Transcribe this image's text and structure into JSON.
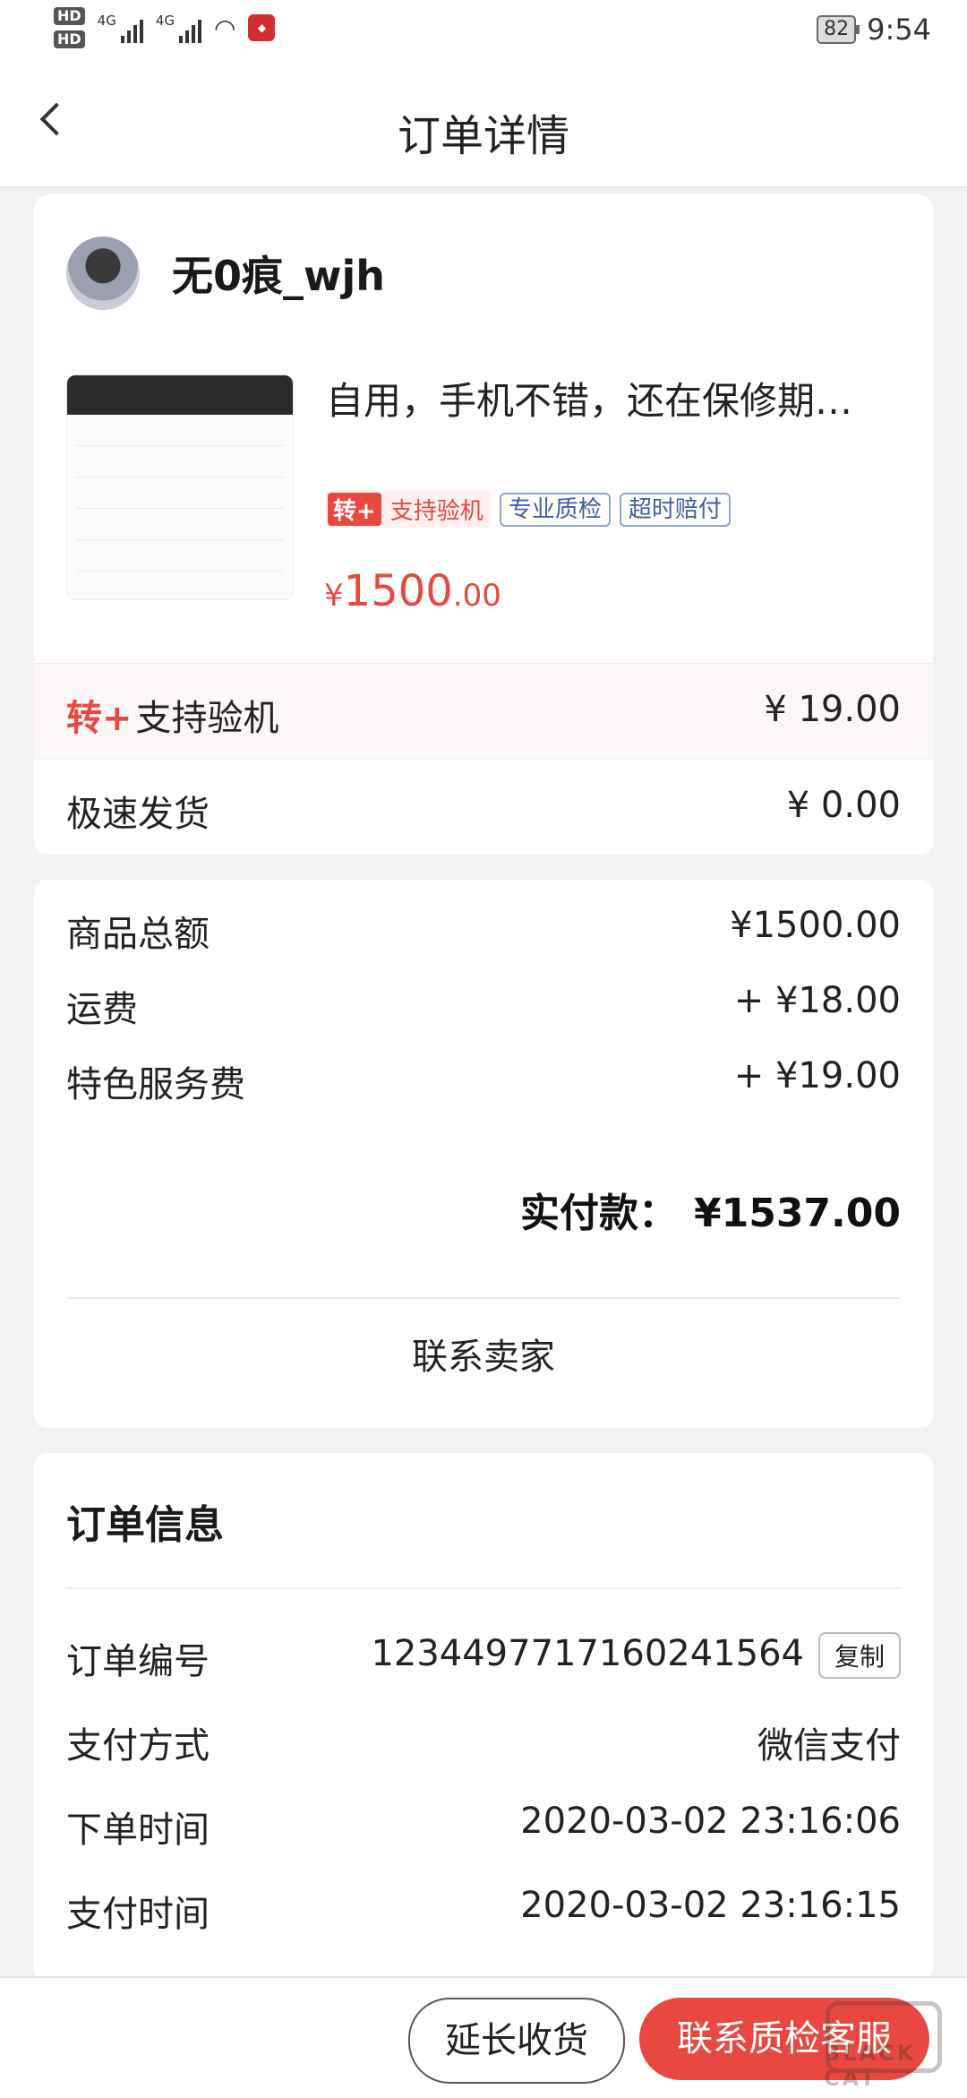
{
  "status_bar": {
    "hd1": "HD",
    "hd2": "HD",
    "net1": "4G",
    "net2": "4G",
    "battery": "82",
    "time": "9:54"
  },
  "nav": {
    "title": "订单详情"
  },
  "seller": {
    "name": "无0痕_wjh"
  },
  "product": {
    "title": "自用，手机不错，还在保修期…",
    "badge_mark": "转+",
    "badge_label": "支持验机",
    "tags": [
      "专业质检",
      "超时赔付"
    ],
    "price_currency": "¥",
    "price_int": "1500",
    "price_dec": ".00"
  },
  "services": [
    {
      "mark": "转+",
      "label": "支持验机",
      "value": "¥ 19.00"
    },
    {
      "label": "极速发货",
      "value": "¥ 0.00"
    }
  ],
  "summary": {
    "goods_total_label": "商品总额",
    "goods_total": "¥1500.00",
    "shipping_label": "运费",
    "shipping": "+ ¥18.00",
    "service_fee_label": "特色服务费",
    "service_fee": "+ ¥19.00",
    "paid_label": "实付款：",
    "paid": "¥1537.00",
    "contact_seller": "联系卖家"
  },
  "order_info": {
    "section_title": "订单信息",
    "order_no_label": "订单编号",
    "order_no": "1234497717160241564",
    "copy": "复制",
    "pay_method_label": "支付方式",
    "pay_method": "微信支付",
    "order_time_label": "下单时间",
    "order_time": "2020-03-02 23:16:06",
    "pay_time_label": "支付时间",
    "pay_time": "2020-03-02 23:16:15"
  },
  "bottom": {
    "extend": "延长收货",
    "contact_qc": "联系质检客服"
  },
  "watermark": "BLACK CAT",
  "colors": {
    "accent": "#e8483f",
    "tag_blue": "#3f5f9e",
    "bg": "#f2f2f2"
  }
}
